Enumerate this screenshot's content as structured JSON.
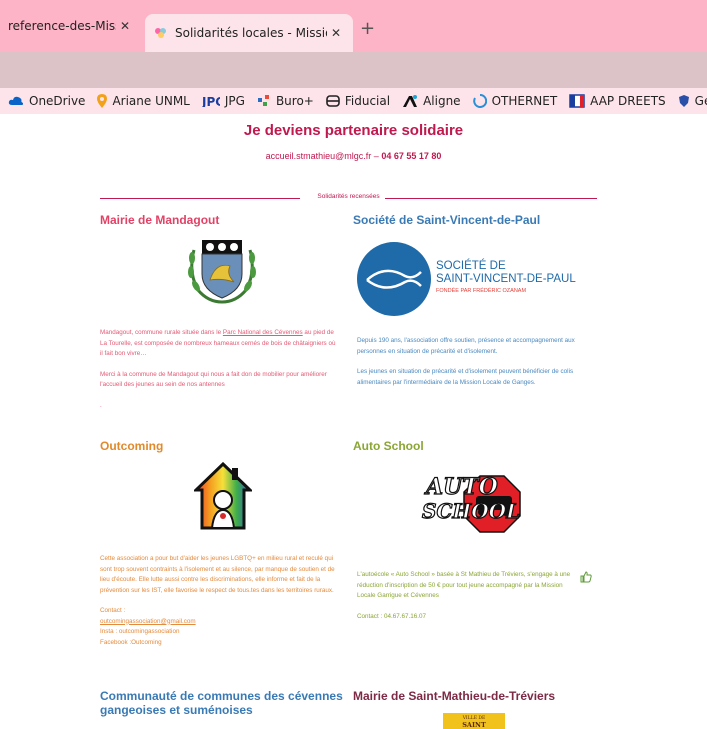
{
  "browser": {
    "tabs": [
      {
        "title": "reference-des-Missio",
        "active": false
      },
      {
        "title": "Solidarités locales - Mission Loc",
        "active": true
      }
    ],
    "new_tab_label": "+",
    "close_label": "✕",
    "bookmarks": [
      {
        "label": "OneDrive",
        "icon": "cloud-icon"
      },
      {
        "label": "Ariane UNML",
        "icon": "pin-icon"
      },
      {
        "label": "JPG",
        "icon": "jpg-icon"
      },
      {
        "label": "Buro+",
        "icon": "buro-icon"
      },
      {
        "label": "Fiducial",
        "icon": "fiducial-icon"
      },
      {
        "label": "Aligne",
        "icon": "aligne-icon"
      },
      {
        "label": "OTHERNET",
        "icon": "othernet-icon"
      },
      {
        "label": "AAP DREETS",
        "icon": "dreets-icon"
      },
      {
        "label": "Géomilo",
        "icon": "shield-icon"
      }
    ]
  },
  "page": {
    "headline": "Je deviens partenaire solidaire",
    "email": "accueil.stmathieu@mlgc.fr",
    "dash": " – ",
    "phone": "04 67 55 17 80",
    "section_label": "Solidarités recensées",
    "cards": {
      "mandagout": {
        "title": "Mairie de Mandagout",
        "p1_before": "Mandagout, commune rurale située dans le ",
        "p1_link": "Parc National des Cévennes",
        "p1_after": " au pied de La Tourelle, est composée de nombreux hameaux cernés de bois de châtaigniers où il fait bon vivre…",
        "p2": "Merci à la commune de Mandagout qui nous a fait don de mobilier pour améliorer l'accueil des jeunes au sein de nos antennes",
        "p3": "."
      },
      "svp": {
        "title": "Société de Saint-Vincent-de-Paul",
        "logo_line1": "SOCIÉTÉ DE",
        "logo_line2": "SAINT-VINCENT-DE-PAUL",
        "logo_line3": "FONDÉE PAR FRÉDÉRIC OZANAM",
        "p1": "Depuis 190 ans, l'association offre soutien, présence et accompagnement aux personnes en situation de précarité et d'isolement.",
        "p2": "Les jeunes en situation de précarité et d'isolement peuvent bénéficier de colis alimentaires par l'intermédiaire de la Mission Locale de Ganges."
      },
      "outcoming": {
        "title": "Outcoming",
        "p1": "Cette association a pour but d'aider les jeunes LGBTQ+ en milieu rural et reculé qui sont trop souvent contraints à l'isolement et au silence, par manque de soutien et de lieu d'écoute. Elle lutte aussi contre les discriminations,  elle informe et fait de la prévention sur les IST,  elle favorise le respect de tous.tes dans les territoires ruraux.",
        "contact_label": "Contact :",
        "email": "outcomingassociation@gmail.com",
        "insta": "Insta : outcomingassociation",
        "facebook": "Facebook :Outcoming"
      },
      "autoschool": {
        "title": "Auto School",
        "logo_top": "AUTO",
        "logo_bottom": "SCHOOL",
        "p1": "L'autoécole « Auto School » basée à St Mathieu de Tréviers, s'engage à une réduction d'inscription de 50 € pour tout jeune accompagné par la Mission Locale Garrigue et Cévennes",
        "contact": "Contact : 04.67.67.16.07"
      },
      "ccgs": {
        "title_line1": "Communauté de communes des cévennes",
        "title_line2": "gangeoises et suménoises"
      },
      "smt": {
        "title": "Mairie de Saint-Mathieu-de-Tréviers",
        "logo_line1": "VILLE DE",
        "logo_line2": "SAINT MATHIEU"
      }
    }
  },
  "colors": {
    "tabstrip": "#fcb4c6",
    "accent": "#c0194f",
    "pink": "#e14266",
    "blue": "#3a7ab4",
    "orange": "#e08a2c",
    "green": "#8aa634",
    "maroon": "#7d2a45"
  }
}
